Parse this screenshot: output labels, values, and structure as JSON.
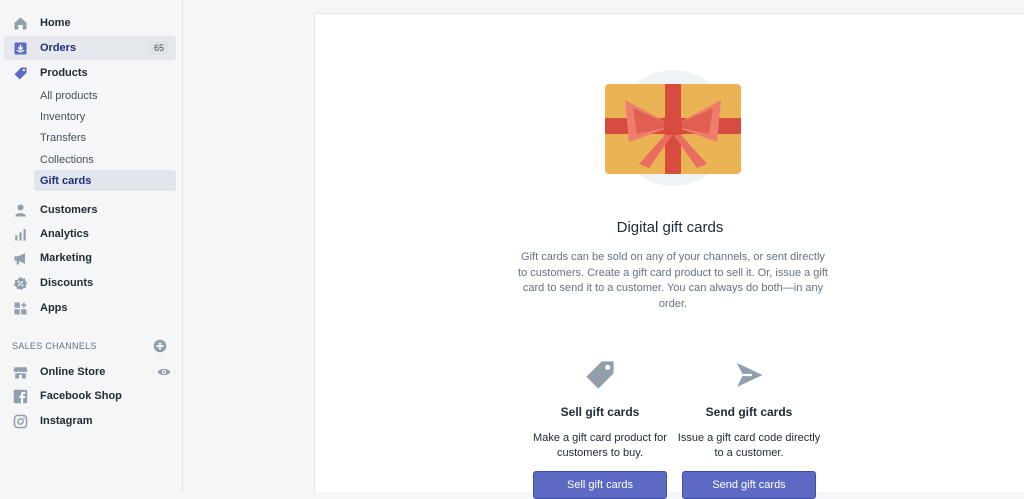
{
  "sidebar": {
    "home": "Home",
    "orders": {
      "label": "Orders",
      "badge": "65"
    },
    "products": "Products",
    "sub_items": [
      "All products",
      "Inventory",
      "Transfers",
      "Collections",
      "Gift cards"
    ],
    "customers": "Customers",
    "analytics": "Analytics",
    "marketing": "Marketing",
    "discounts": "Discounts",
    "apps": "Apps",
    "sales_channels_header": "SALES CHANNELS",
    "channels": [
      "Online Store",
      "Facebook Shop",
      "Instagram"
    ]
  },
  "main": {
    "title": "Digital gift cards",
    "description": "Gift cards can be sold on any of your channels, or sent directly to customers. Create a gift card product to sell it. Or, issue a gift card to send it to a customer. You can always do both—in any order.",
    "sell": {
      "title": "Sell gift cards",
      "desc": "Make a gift card product for customers to buy.",
      "button": "Sell gift cards"
    },
    "send": {
      "title": "Send gift cards",
      "desc": "Issue a gift card code directly to a customer.",
      "button": "Send gift cards"
    }
  },
  "colors": {
    "accent": "#5c6ac4",
    "sidebar_icon": "#919eab",
    "card_gold": "#eab353",
    "ribbon_red": "#d84b3f"
  }
}
